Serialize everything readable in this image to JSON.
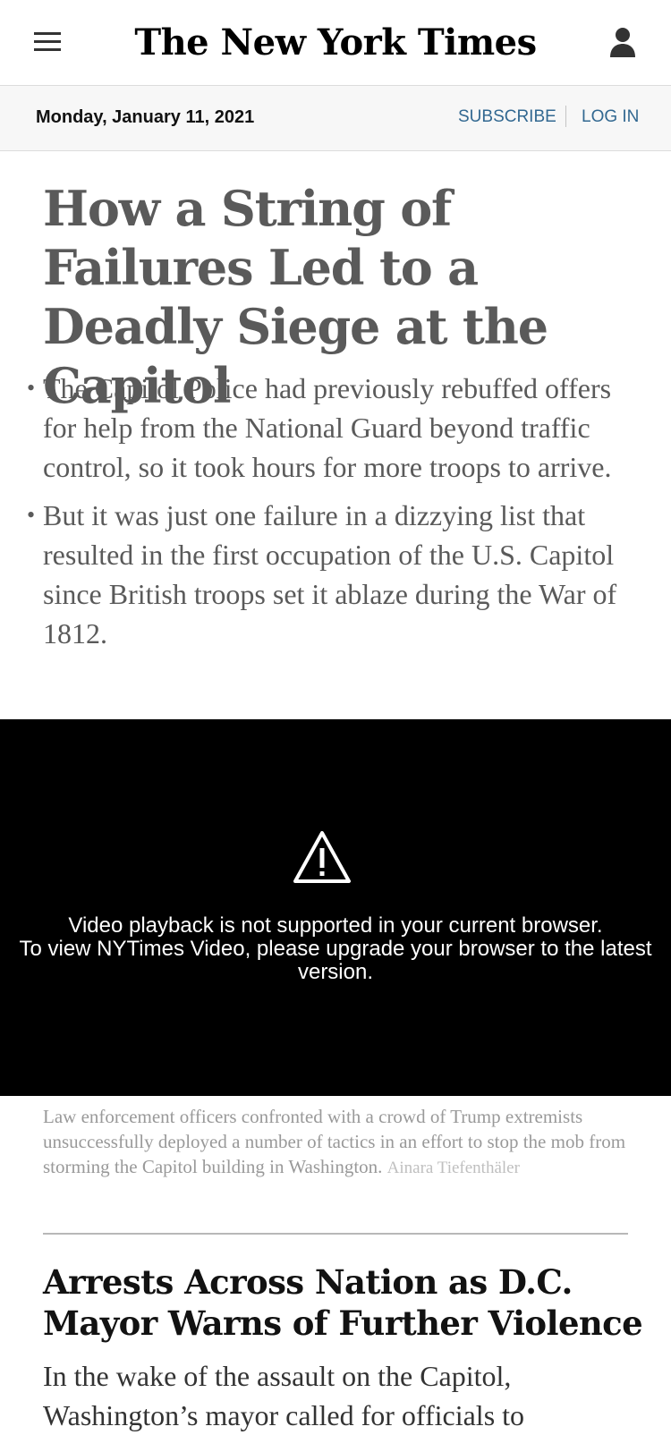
{
  "masthead": {
    "logo_text": "The New York Times",
    "menu_icon": "hamburger-menu-icon",
    "account_icon": "user-account-icon"
  },
  "datebar": {
    "date": "Monday, January 11, 2021",
    "subscribe_label": "SUBSCRIBE",
    "login_label": "LOG IN",
    "link_color": "#326891"
  },
  "lead_story": {
    "headline": "How a String of Failures Led to a Deadly Siege at the Capitol",
    "summary": [
      "The Capitol Police had previously rebuffed offers for help from the National Guard beyond traffic control, so it took hours for more troops to arrive.",
      "But it was just one failure in a dizzying list that resulted in the first occupation of the U.S. Capitol since British troops set it ablaze during the War of 1812."
    ],
    "bullet": "•"
  },
  "video": {
    "icon": "warning-triangle-icon",
    "message_line1": "Video playback is not supported in your current browser.",
    "message_line2": "To view NYTimes Video, please upgrade your browser to the latest version.",
    "caption": "Law enforcement officers confronted with a crowd of Trump extremists unsuccessfully deployed a number of tactics in an effort to stop the mob from storming the Capitol building in Washington.",
    "credit": "Ainara Tiefenthäler"
  },
  "second_story": {
    "headline": "Arrests Across Nation as D.C. Mayor Warns of Further Violence",
    "summary": "In the wake of the assault on the Capitol, Washington’s mayor called for officials to"
  }
}
